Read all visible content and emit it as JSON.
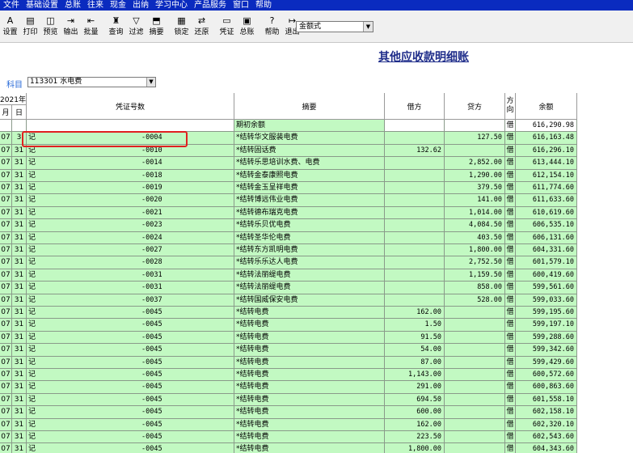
{
  "menu": [
    "文件",
    "基础设置",
    "总账",
    "往来",
    "现金",
    "出纳",
    "学习中心",
    "产品服务",
    "窗口",
    "帮助"
  ],
  "toolbar": [
    {
      "label": "设置",
      "icon": "settings-icon",
      "glyph": "A"
    },
    {
      "label": "打印",
      "icon": "print-icon",
      "glyph": "▤"
    },
    {
      "label": "预览",
      "icon": "preview-icon",
      "glyph": "◫"
    },
    {
      "label": "输出",
      "icon": "export-icon",
      "glyph": "⇥"
    },
    {
      "label": "批量",
      "icon": "batch-icon",
      "glyph": "⇤"
    },
    {
      "label": "查询",
      "icon": "query-icon",
      "glyph": "♜"
    },
    {
      "label": "过滤",
      "icon": "filter-icon",
      "glyph": "▽"
    },
    {
      "label": "摘要",
      "icon": "summary-icon",
      "glyph": "⬒"
    },
    {
      "label": "锁定",
      "icon": "lock-icon",
      "glyph": "▦"
    },
    {
      "label": "还原",
      "icon": "restore-icon",
      "glyph": "⇄"
    },
    {
      "label": "凭证",
      "icon": "voucher-icon",
      "glyph": "▭"
    },
    {
      "label": "总账",
      "icon": "ledger-icon",
      "glyph": "▣"
    },
    {
      "label": "帮助",
      "icon": "help-icon",
      "glyph": "?"
    },
    {
      "label": "退出",
      "icon": "exit-icon",
      "glyph": "↦"
    }
  ],
  "format_select": "金额式",
  "title": "其他应收款明细账",
  "account": {
    "label": "科目",
    "value": "113301 水电费"
  },
  "columns": {
    "year": "2021年",
    "month": "月",
    "day": "日",
    "voucher": "凭证号数",
    "summary": "摘要",
    "debit": "借方",
    "credit": "贷方",
    "direction": "方向",
    "balance": "余额"
  },
  "rows": [
    {
      "m": "",
      "d": "",
      "vt": "",
      "vn": "",
      "s": "期初余额",
      "dr": "",
      "cr": "",
      "dir": "借",
      "bal": "616,290.98"
    },
    {
      "m": "07",
      "d": "3",
      "vt": "记",
      "vn": "-0004",
      "s": "*结转华文服装电费",
      "dr": "",
      "cr": "127.50",
      "dir": "借",
      "bal": "616,163.48"
    },
    {
      "m": "07",
      "d": "31",
      "vt": "记",
      "vn": "-0010",
      "s": "*结转固话费",
      "dr": "132.62",
      "cr": "",
      "dir": "借",
      "bal": "616,296.10"
    },
    {
      "m": "07",
      "d": "31",
      "vt": "记",
      "vn": "-0014",
      "s": "*结转乐思培训水费、电费",
      "dr": "",
      "cr": "2,852.00",
      "dir": "借",
      "bal": "613,444.10"
    },
    {
      "m": "07",
      "d": "31",
      "vt": "记",
      "vn": "-0018",
      "s": "*结转金泰康照电费",
      "dr": "",
      "cr": "1,290.00",
      "dir": "借",
      "bal": "612,154.10"
    },
    {
      "m": "07",
      "d": "31",
      "vt": "记",
      "vn": "-0019",
      "s": "*结转金玉呈祥电费",
      "dr": "",
      "cr": "379.50",
      "dir": "借",
      "bal": "611,774.60"
    },
    {
      "m": "07",
      "d": "31",
      "vt": "记",
      "vn": "-0020",
      "s": "*结转博远伟业电费",
      "dr": "",
      "cr": "141.00",
      "dir": "借",
      "bal": "611,633.60"
    },
    {
      "m": "07",
      "d": "31",
      "vt": "记",
      "vn": "-0021",
      "s": "*结转德布瑞克电费",
      "dr": "",
      "cr": "1,014.00",
      "dir": "借",
      "bal": "610,619.60"
    },
    {
      "m": "07",
      "d": "31",
      "vt": "记",
      "vn": "-0023",
      "s": "*结转乐贝优电费",
      "dr": "",
      "cr": "4,084.50",
      "dir": "借",
      "bal": "606,535.10"
    },
    {
      "m": "07",
      "d": "31",
      "vt": "记",
      "vn": "-0024",
      "s": "*结转圣华伦电费",
      "dr": "",
      "cr": "403.50",
      "dir": "借",
      "bal": "606,131.60"
    },
    {
      "m": "07",
      "d": "31",
      "vt": "记",
      "vn": "-0027",
      "s": "*结转东方凯明电费",
      "dr": "",
      "cr": "1,800.00",
      "dir": "借",
      "bal": "604,331.60"
    },
    {
      "m": "07",
      "d": "31",
      "vt": "记",
      "vn": "-0028",
      "s": "*结转乐乐达人电费",
      "dr": "",
      "cr": "2,752.50",
      "dir": "借",
      "bal": "601,579.10"
    },
    {
      "m": "07",
      "d": "31",
      "vt": "记",
      "vn": "-0031",
      "s": "*结转法丽缇电费",
      "dr": "",
      "cr": "1,159.50",
      "dir": "借",
      "bal": "600,419.60"
    },
    {
      "m": "07",
      "d": "31",
      "vt": "记",
      "vn": "-0031",
      "s": "*结转法丽缇电费",
      "dr": "",
      "cr": "858.00",
      "dir": "借",
      "bal": "599,561.60"
    },
    {
      "m": "07",
      "d": "31",
      "vt": "记",
      "vn": "-0037",
      "s": "*结转国威保安电费",
      "dr": "",
      "cr": "528.00",
      "dir": "借",
      "bal": "599,033.60"
    },
    {
      "m": "07",
      "d": "31",
      "vt": "记",
      "vn": "-0045",
      "s": "*结转电费",
      "dr": "162.00",
      "cr": "",
      "dir": "借",
      "bal": "599,195.60"
    },
    {
      "m": "07",
      "d": "31",
      "vt": "记",
      "vn": "-0045",
      "s": "*结转电费",
      "dr": "1.50",
      "cr": "",
      "dir": "借",
      "bal": "599,197.10"
    },
    {
      "m": "07",
      "d": "31",
      "vt": "记",
      "vn": "-0045",
      "s": "*结转电费",
      "dr": "91.50",
      "cr": "",
      "dir": "借",
      "bal": "599,288.60"
    },
    {
      "m": "07",
      "d": "31",
      "vt": "记",
      "vn": "-0045",
      "s": "*结转电费",
      "dr": "54.00",
      "cr": "",
      "dir": "借",
      "bal": "599,342.60"
    },
    {
      "m": "07",
      "d": "31",
      "vt": "记",
      "vn": "-0045",
      "s": "*结转电费",
      "dr": "87.00",
      "cr": "",
      "dir": "借",
      "bal": "599,429.60"
    },
    {
      "m": "07",
      "d": "31",
      "vt": "记",
      "vn": "-0045",
      "s": "*结转电费",
      "dr": "1,143.00",
      "cr": "",
      "dir": "借",
      "bal": "600,572.60"
    },
    {
      "m": "07",
      "d": "31",
      "vt": "记",
      "vn": "-0045",
      "s": "*结转电费",
      "dr": "291.00",
      "cr": "",
      "dir": "借",
      "bal": "600,863.60"
    },
    {
      "m": "07",
      "d": "31",
      "vt": "记",
      "vn": "-0045",
      "s": "*结转电费",
      "dr": "694.50",
      "cr": "",
      "dir": "借",
      "bal": "601,558.10"
    },
    {
      "m": "07",
      "d": "31",
      "vt": "记",
      "vn": "-0045",
      "s": "*结转电费",
      "dr": "600.00",
      "cr": "",
      "dir": "借",
      "bal": "602,158.10"
    },
    {
      "m": "07",
      "d": "31",
      "vt": "记",
      "vn": "-0045",
      "s": "*结转电费",
      "dr": "162.00",
      "cr": "",
      "dir": "借",
      "bal": "602,320.10"
    },
    {
      "m": "07",
      "d": "31",
      "vt": "记",
      "vn": "-0045",
      "s": "*结转电费",
      "dr": "223.50",
      "cr": "",
      "dir": "借",
      "bal": "602,543.60"
    },
    {
      "m": "07",
      "d": "31",
      "vt": "记",
      "vn": "-0045",
      "s": "*结转电费",
      "dr": "1,800.00",
      "cr": "",
      "dir": "借",
      "bal": "604,343.60"
    }
  ],
  "highlight_color": "#e02020",
  "row_color": "#c2f9c2"
}
